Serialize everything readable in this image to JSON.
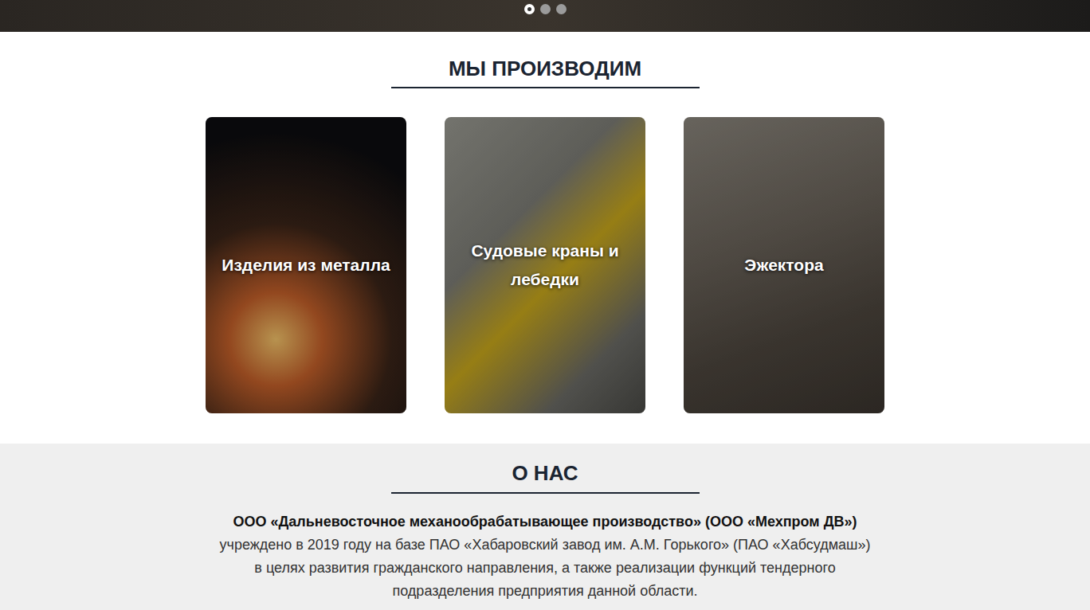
{
  "hero": {
    "slider_dots": [
      {
        "selected": true
      },
      {
        "selected": false
      },
      {
        "selected": false
      }
    ]
  },
  "products": {
    "title": "МЫ ПРОИЗВОДИМ",
    "cards": [
      {
        "label": "Изделия из металла"
      },
      {
        "label": "Судовые краны и лебедки"
      },
      {
        "label": "Эжектора"
      }
    ]
  },
  "about": {
    "title": "О НАС",
    "lines": [
      {
        "text": "ООО «Дальневосточное механообрабатывающее производство» (ООО «Мехпром ДВ»)",
        "bold": true
      },
      {
        "text": "учреждено в 2019 году на базе ПАО «Хабаровский завод им. А.М. Горького» (ПАО «Хабсудмаш»)",
        "bold": false
      },
      {
        "text": "в целях развития гражданского направления, а также реализации функций тендерного",
        "bold": false
      },
      {
        "text": "подразделения предприятия данной области.",
        "bold": false
      }
    ]
  }
}
